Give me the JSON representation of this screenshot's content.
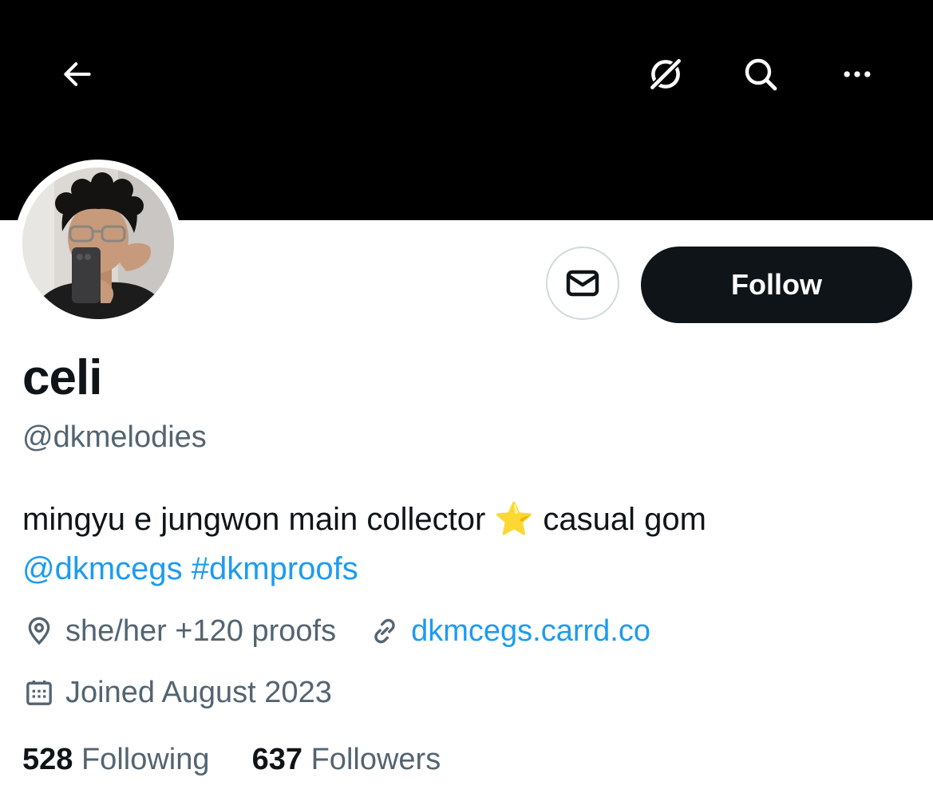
{
  "header": {
    "back_icon": "arrow-left-icon",
    "grok_icon": "grok-icon",
    "search_icon": "search-icon",
    "more_icon": "more-horizontal-icon",
    "banner_color": "#000000"
  },
  "profile": {
    "avatar_icon": "profile-photo",
    "display_name": "celi",
    "handle": "@dkmelodies",
    "bio_text": "mingyu e jungwon main collector",
    "bio_emoji": "⭐",
    "bio_text_after": "casual gom",
    "bio_mention": "@dkmcegs",
    "bio_hashtag": "#dkmproofs",
    "location": "she/her +120 proofs",
    "website": "dkmcegs.carrd.co",
    "joined": "Joined August 2023",
    "following_count": "528",
    "following_label": "Following",
    "followers_count": "637",
    "followers_label": "Followers"
  },
  "actions": {
    "message_icon": "envelope-icon",
    "follow_label": "Follow"
  },
  "colors": {
    "link": "#1d9bf0",
    "secondary_text": "#536471",
    "primary_text": "#0f1419",
    "follow_bg": "#0f1419"
  }
}
